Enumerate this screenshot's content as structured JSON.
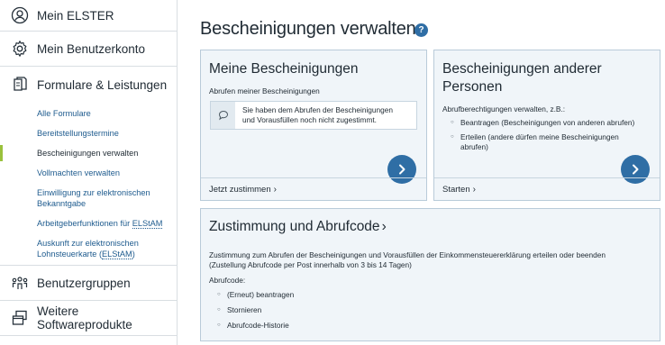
{
  "sidebar": {
    "mein_elster": "Mein ELSTER",
    "benutzerkonto": "Mein Benutzerkonto",
    "formulare": "Formulare & Leistungen",
    "sub_items": [
      "Alle Formulare",
      "Bereitstellungstermine",
      "Bescheinigungen verwalten",
      "Vollmachten verwalten",
      "Einwilligung zur elektronischen",
      "Bekanntgabe",
      "Arbeitgeberfunktionen für ",
      "ELStAM",
      "Auskunft zur elektronischen",
      "Lohnsteuerkarte (",
      "ELStAM",
      ")"
    ],
    "benutzergruppen": "Benutzergruppen",
    "software": "Weitere Softwareprodukte"
  },
  "page": {
    "title": "Bescheinigungen verwalten",
    "help": "?"
  },
  "card1": {
    "title": "Meine Bescheinigungen",
    "subtitle": "Abrufen meiner Bescheinigungen",
    "info_line1": "Sie haben dem Abrufen der Bescheinigungen",
    "info_line2": "und Vorausfüllen noch nicht zugestimmt.",
    "footer": "Jetzt zustimmen"
  },
  "card2": {
    "title_line1": "Bescheinigungen anderer",
    "title_line2": "Personen",
    "intro": "Abrufberechtigungen verwalten, z.B.:",
    "bullet1": "Beantragen (Bescheinigungen von anderen abrufen)",
    "bullet2_line1": "Erteilen (andere dürfen meine Bescheinigungen",
    "bullet2_line2": "abrufen)",
    "footer": "Starten"
  },
  "card3": {
    "title": "Zustimmung und Abrufcode",
    "line1": "Zustimmung zum Abrufen der Bescheinigungen und Vorausfüllen der Einkommensteuererklärung erteilen oder beenden",
    "line2": "(Zustellung Abrufcode per Post innerhalb von 3 bis 14 Tagen)",
    "label": "Abrufcode:",
    "bullets": [
      "(Erneut) beantragen",
      "Stornieren",
      "Abrufcode-Historie"
    ]
  },
  "colors": {
    "accent": "#2f6ea5",
    "active_marker": "#9ac13c",
    "link": "#1e5b8e",
    "card_bg": "#f0f5f9"
  },
  "icons": {
    "mein_elster": "user-circle-icon",
    "benutzerkonto": "gear-icon",
    "formulare": "documents-icon",
    "benutzergruppen": "group-icon",
    "software": "windows-icon",
    "info": "speech-bubble-icon",
    "go": "chevron-right-icon"
  }
}
